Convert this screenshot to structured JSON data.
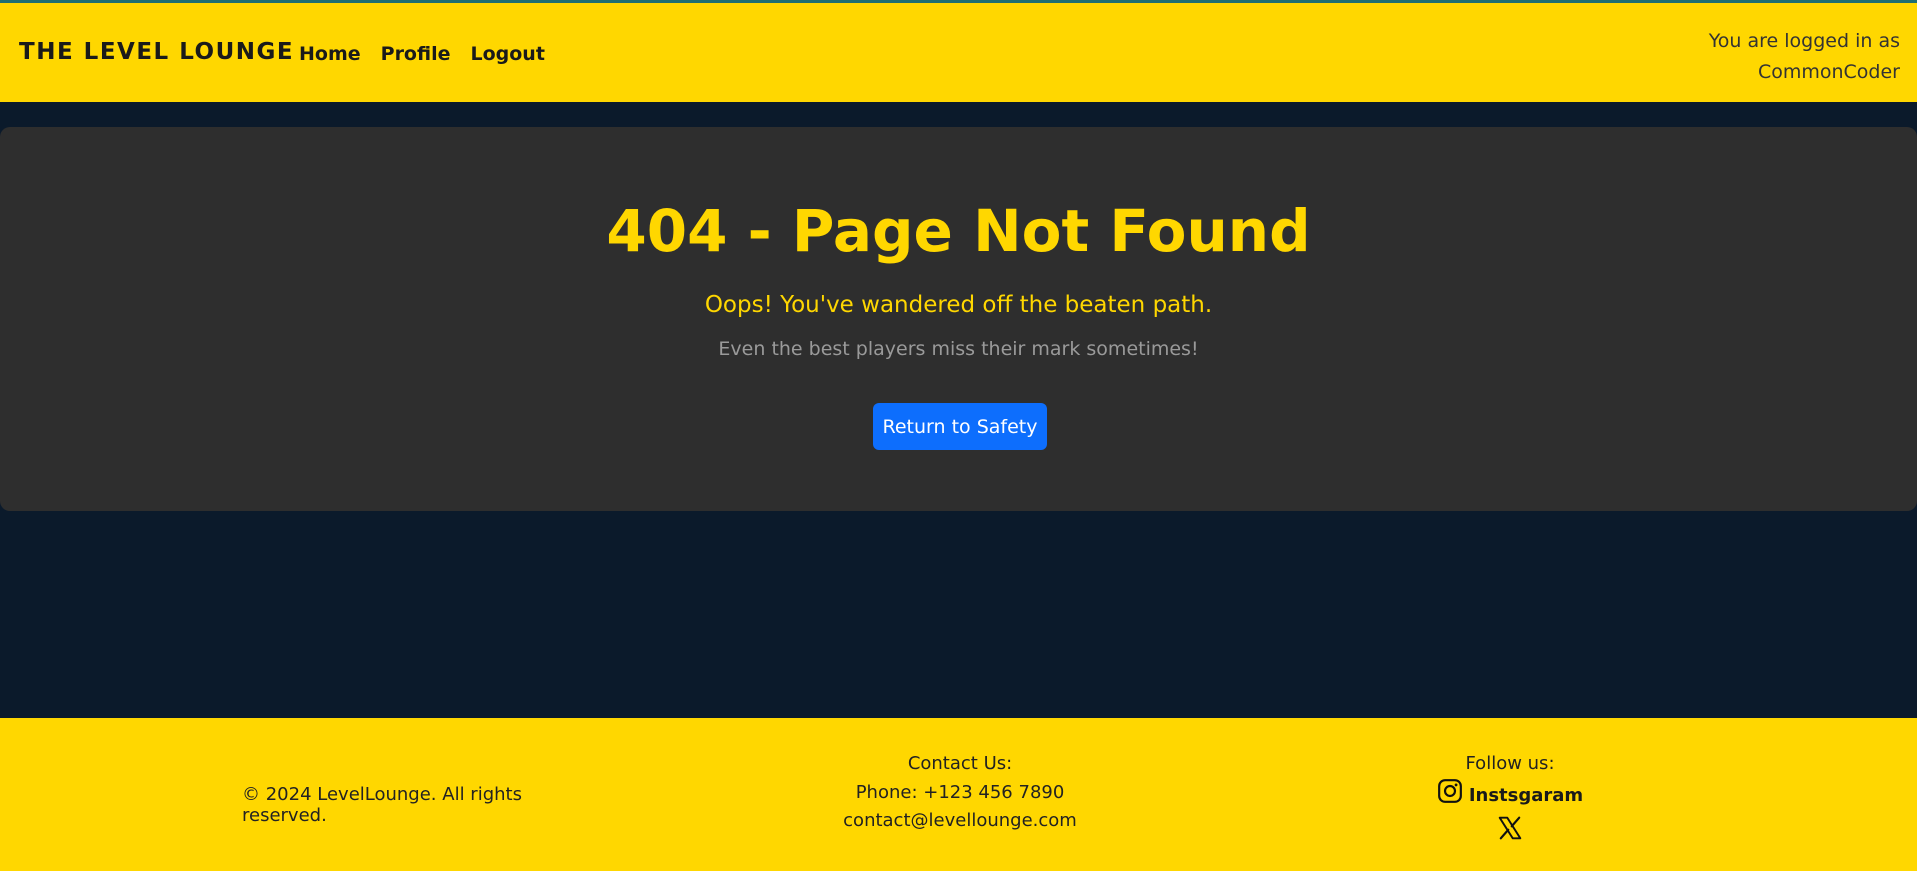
{
  "header": {
    "brand": "THE LEVEL LOUNGE",
    "nav": [
      {
        "label": "Home"
      },
      {
        "label": "Profile"
      },
      {
        "label": "Logout"
      }
    ],
    "login_line1": "You are logged in as",
    "login_user": "CommonCoder"
  },
  "error": {
    "title": "404 - Page Not Found",
    "subtitle": "Oops! You've wandered off the beaten path.",
    "text": "Even the best players miss their mark sometimes!",
    "button_label": "Return to Safety"
  },
  "footer": {
    "copyright": "© 2024 LevelLounge. All rights reserved.",
    "contact_heading": "Contact Us:",
    "phone": "Phone: +123 456 7890",
    "email": "contact@levellounge.com",
    "follow_heading": "Follow us:",
    "instagram_label": "Instsgaram",
    "instagram_icon": "instagram-icon",
    "x_icon": "x-icon"
  },
  "colors": {
    "accent": "#ffd700",
    "background": "#0b1a2b",
    "card": "#2e2e2e",
    "button": "#0d6efd"
  }
}
